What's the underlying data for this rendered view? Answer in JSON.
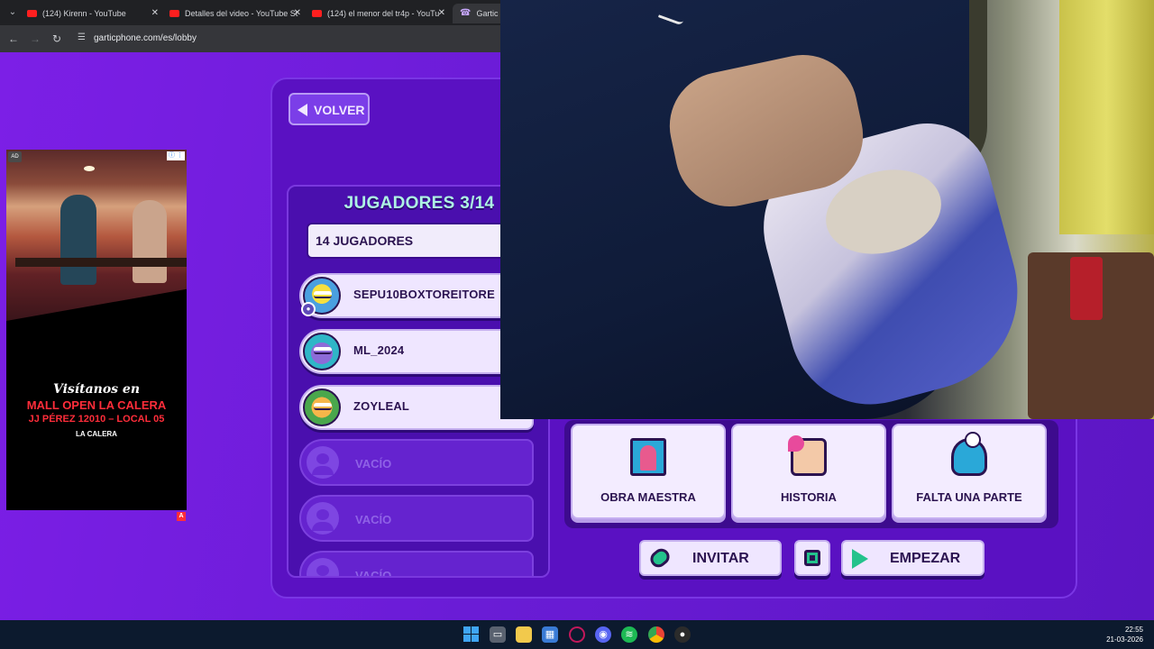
{
  "browser": {
    "tabs": [
      {
        "title": "(124) Kirenn - YouTube",
        "favicon": "youtube-icon"
      },
      {
        "title": "Detalles del video - YouTube St",
        "favicon": "youtube-studio-icon"
      },
      {
        "title": "(124) el menor del tr4p - YouTu",
        "favicon": "youtube-icon"
      },
      {
        "title": "Gartic Ph",
        "favicon": "gartic-phone-icon"
      }
    ],
    "url": "garticphone.com/es/lobby"
  },
  "ad": {
    "badge": "AD",
    "line1": "Visítanos en",
    "line2": "MALL OPEN LA CALERA",
    "line3": "JJ PÉREZ 12010 – LOCAL 05",
    "line4": "LA CALERA",
    "choice": "A"
  },
  "lobby": {
    "back_label": "VOLVER",
    "players_title": "JUGADORES 3/14",
    "player_count_select": "14 JUGADORES",
    "players": [
      {
        "name": "SEPU10BOXTOREITORE",
        "host": true
      },
      {
        "name": "ML_2024",
        "host": false
      },
      {
        "name": "ZOYLEAL",
        "host": false
      }
    ],
    "empty_label": "VACÍO",
    "modes": [
      {
        "label": "OBRA MAESTRA",
        "icon": "masterpiece-frame-icon"
      },
      {
        "label": "HISTORIA",
        "icon": "story-scroll-icon"
      },
      {
        "label": "FALTA UNA PARTE",
        "icon": "missing-piece-icon"
      }
    ],
    "invite_label": "INVITAR",
    "start_label": "EMPEZAR"
  },
  "taskbar": {
    "time": "22:55",
    "date": "21-03-2026"
  },
  "colors": {
    "page_bg": "#6a1cd6",
    "title_accent": "#aef3e4",
    "button_text": "#2b1350",
    "green_icon": "#23c28c"
  }
}
